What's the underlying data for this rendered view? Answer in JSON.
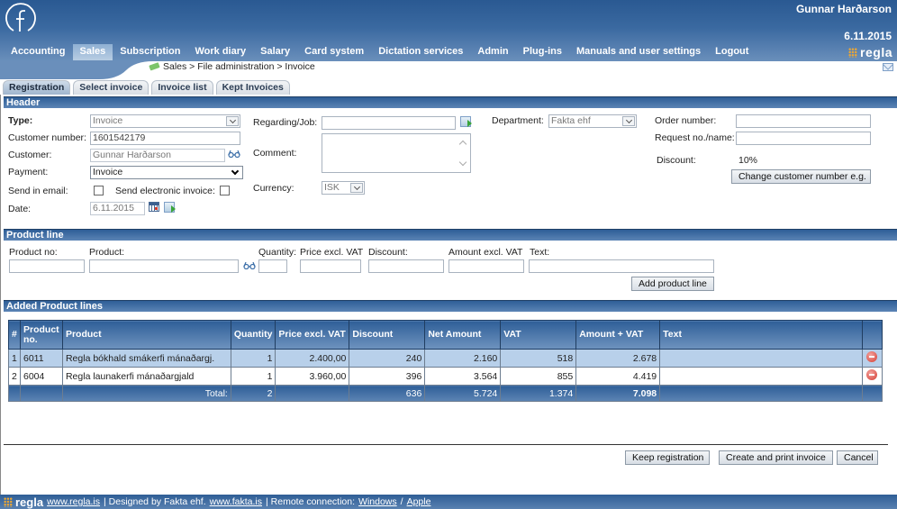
{
  "top": {
    "user_name": "Gunnar Harðarson",
    "date": "6.11.2015",
    "brand": "regla",
    "breadcrumb": "Sales > File administration > Invoice"
  },
  "nav": {
    "items": [
      {
        "label": "Accounting",
        "active": false
      },
      {
        "label": "Sales",
        "active": true
      },
      {
        "label": "Subscription",
        "active": false
      },
      {
        "label": "Work diary",
        "active": false
      },
      {
        "label": "Salary",
        "active": false
      },
      {
        "label": "Card system",
        "active": false
      },
      {
        "label": "Dictation services",
        "active": false
      },
      {
        "label": "Admin",
        "active": false
      },
      {
        "label": "Plug-ins",
        "active": false
      },
      {
        "label": "Manuals and user settings",
        "active": false
      },
      {
        "label": "Logout",
        "active": false
      }
    ]
  },
  "tabs": [
    {
      "label": "Registration",
      "active": true
    },
    {
      "label": "Select invoice",
      "active": false
    },
    {
      "label": "Invoice list",
      "active": false
    },
    {
      "label": "Kept Invoices",
      "active": false
    }
  ],
  "header_section": {
    "title": "Header",
    "type_label": "Type:",
    "type_value": "Invoice",
    "customer_number_label": "Customer number:",
    "customer_number_value": "1601542179",
    "customer_label": "Customer:",
    "customer_value": "Gunnar Harðarson",
    "payment_label": "Payment:",
    "payment_value": "Invoice",
    "send_email_label": "Send in email:",
    "send_email_checked": false,
    "send_einvoice_label": "Send electronic invoice:",
    "send_einvoice_checked": false,
    "date_label": "Date:",
    "date_value": "6.11.2015",
    "regarding_label": "Regarding/Job:",
    "regarding_value": "",
    "comment_label": "Comment:",
    "comment_value": "",
    "currency_label": "Currency:",
    "currency_value": "ISK",
    "department_label": "Department:",
    "department_value": "Fakta ehf",
    "order_number_label": "Order number:",
    "order_number_value": "",
    "request_label": "Request no./name:",
    "request_value": "",
    "discount_label": "Discount:",
    "discount_value": "10%",
    "change_customer_button": "Change customer number e.g."
  },
  "product_line": {
    "title": "Product line",
    "labels": {
      "product_no": "Product no:",
      "product": "Product:",
      "quantity": "Quantity:",
      "price": "Price excl. VAT",
      "discount": "Discount:",
      "amount": "Amount excl. VAT",
      "text": "Text:"
    },
    "add_button": "Add product line"
  },
  "added_lines": {
    "title": "Added Product lines",
    "columns": [
      "#",
      "Product no.",
      "Product",
      "Quantity",
      "Price excl. VAT",
      "Discount",
      "Net Amount",
      "VAT",
      "Amount + VAT",
      "Text",
      ""
    ],
    "rows": [
      {
        "n": "1",
        "product_no": "6011",
        "product": "Regla bókhald smákerfi mánaðargj.",
        "quantity": "1",
        "price": "2.400,00",
        "discount": "240",
        "net": "2.160",
        "vat": "518",
        "total": "2.678",
        "text": ""
      },
      {
        "n": "2",
        "product_no": "6004",
        "product": "Regla launakerfi mánaðargjald",
        "quantity": "1",
        "price": "3.960,00",
        "discount": "396",
        "net": "3.564",
        "vat": "855",
        "total": "4.419",
        "text": ""
      }
    ],
    "totals": {
      "label": "Total:",
      "quantity": "2",
      "discount": "636",
      "net": "5.724",
      "vat": "1.374",
      "total": "7.098"
    }
  },
  "actions": {
    "keep": "Keep registration",
    "create": "Create and print invoice",
    "cancel": "Cancel"
  },
  "footer": {
    "brand": "regla",
    "link1": "www.regla.is",
    "sep1": "| Designed by Fakta ehf.",
    "link2": "www.fakta.is",
    "sep2": "| Remote connection:",
    "link3": "Windows",
    "slash": "/",
    "link4": "Apple"
  }
}
